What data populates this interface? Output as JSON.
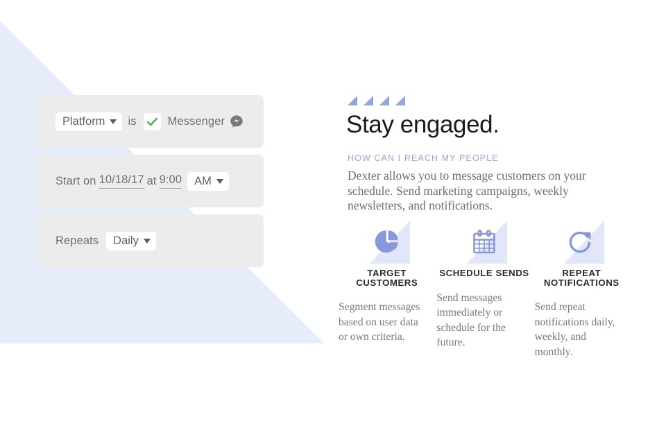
{
  "theme": {
    "bg_triangle_color": "#e7ecfb",
    "accent_periwinkle": "#93a6e0",
    "icon_blue": "#8898db",
    "icon_backdrop": "#e1e7f9",
    "card_bg": "#ececec",
    "pill_bg": "#ffffff",
    "text_gray": "#6f7072",
    "headline_color": "#1b1b1d",
    "check_green": "#4caf50",
    "messenger_gray": "#77787a"
  },
  "left_panel": {
    "cards": [
      {
        "name": "platform-rule",
        "select_label": "Platform",
        "connector": "is",
        "check_icon": "check-icon",
        "value_label": "Messenger",
        "value_icon": "messenger-icon"
      },
      {
        "name": "schedule-rule",
        "prefix": "Start on",
        "date_value": "10/18/17",
        "middle": "at",
        "time_value": "9:00",
        "meridiem_label": "AM"
      },
      {
        "name": "repeat-rule",
        "prefix": "Repeats",
        "frequency_label": "Daily"
      }
    ]
  },
  "right_panel": {
    "decor_arrows_count": 4,
    "decor_arrow_icon": "triangle-marker-icon",
    "headline": "Stay engaged.",
    "eyebrow": "HOW CAN I REACH MY PEOPLE",
    "lede": "Dexter allows you to message customers on your schedule. Send marketing campaigns, weekly newsletters, and notifications.",
    "features": [
      {
        "icon": "pie-chart-icon",
        "title_line1": "TARGET",
        "title_line2": "CUSTOMERS",
        "body": "Segment messages based on user data or own criteria."
      },
      {
        "icon": "calendar-icon",
        "title_line1": "SCHEDULE SENDS",
        "title_line2": "",
        "body": "Send messages immediately or schedule for the future."
      },
      {
        "icon": "repeat-refresh-icon",
        "title_line1": "REPEAT",
        "title_line2": "NOTIFICATIONS",
        "body": "Send repeat notifications daily, weekly, and monthly."
      }
    ]
  }
}
